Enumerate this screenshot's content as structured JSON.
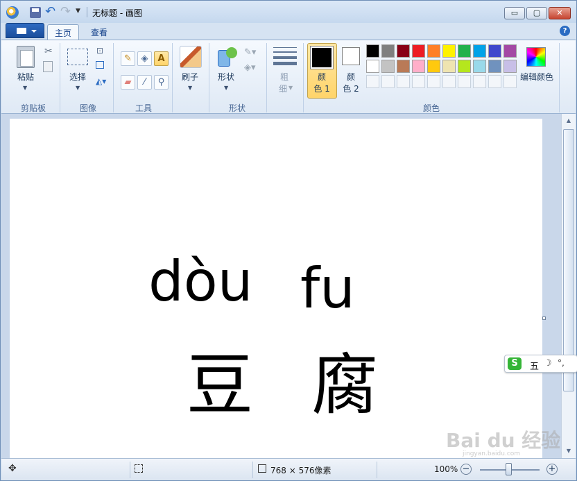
{
  "window": {
    "title": "无标题 - 画图",
    "controls": {
      "minimize": "▭",
      "maximize": "▢",
      "close": "✕"
    }
  },
  "tabs": [
    {
      "label": "主页",
      "active": true
    },
    {
      "label": "查看",
      "active": false
    }
  ],
  "ribbon": {
    "clipboard": {
      "paste": "粘贴",
      "group": "剪贴板"
    },
    "image": {
      "select": "选择",
      "group": "图像"
    },
    "tools": {
      "group": "工具",
      "text_tool": "A"
    },
    "brush": {
      "label": "刷子"
    },
    "shapes": {
      "label": "形状",
      "group": "形状"
    },
    "size": {
      "line1": "粗",
      "line2": "细"
    },
    "colors": {
      "color1_line1": "颜",
      "color1_line2": "色 1",
      "color2_line1": "颜",
      "color2_line2": "色 2",
      "edit": "编辑颜色",
      "group": "颜色",
      "color1_value": "#000000",
      "color2_value": "#ffffff",
      "palette_row1": [
        "#000000",
        "#7f7f7f",
        "#880015",
        "#ed1c24",
        "#ff7f27",
        "#fff200",
        "#22b14c",
        "#00a2e8",
        "#3f48cc",
        "#a349a4"
      ],
      "palette_row2": [
        "#ffffff",
        "#c3c3c3",
        "#b97a57",
        "#ffaec9",
        "#ffc90e",
        "#efe4b0",
        "#b5e61d",
        "#99d9ea",
        "#7092be",
        "#c8bfe7"
      ],
      "palette_row3": [
        "",
        "",
        "",
        "",
        "",
        "",
        "",
        "",
        "",
        ""
      ]
    }
  },
  "canvas": {
    "pinyin_1": "dòu",
    "pinyin_2": "fu",
    "hanzi_1": "豆",
    "hanzi_2": "腐"
  },
  "ime": {
    "mode": "五",
    "punct": "°,"
  },
  "status": {
    "canvas_size": "768 × 576像素",
    "zoom": "100%"
  },
  "watermark": {
    "text": "Bai du 经验",
    "sub": "jingyan.baidu.com"
  }
}
